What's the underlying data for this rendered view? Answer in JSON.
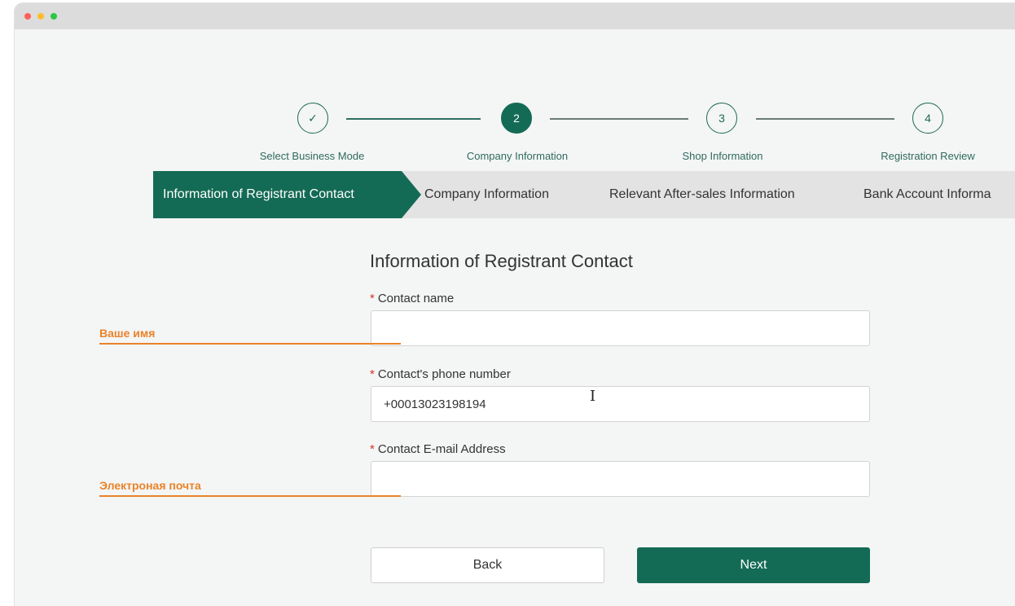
{
  "stepper": {
    "steps": [
      {
        "label": "Select Business Mode",
        "marker": "✓",
        "state": "completed"
      },
      {
        "label": "Company Information",
        "marker": "2",
        "state": "active"
      },
      {
        "label": "Shop Information",
        "marker": "3",
        "state": "pending"
      },
      {
        "label": "Registration Review",
        "marker": "4",
        "state": "pending"
      }
    ]
  },
  "substeps": [
    {
      "label": "Information of Registrant Contact",
      "state": "active"
    },
    {
      "label": "Company Information",
      "state": "inactive"
    },
    {
      "label": "Relevant After-sales Information",
      "state": "inactive"
    },
    {
      "label": "Bank Account Informa",
      "state": "inactive"
    }
  ],
  "form": {
    "title": "Information of Registrant Contact",
    "required_mark": "*",
    "contact_name": {
      "label": "Contact name",
      "value": ""
    },
    "contact_phone": {
      "label": "Contact's phone number",
      "value": "+00013023198194"
    },
    "contact_email": {
      "label": "Contact E-mail Address",
      "value": ""
    }
  },
  "annotations": {
    "name": "Ваше имя",
    "email": "Электроная почта"
  },
  "buttons": {
    "back": "Back",
    "next": "Next"
  },
  "colors": {
    "accent": "#146b55",
    "annotation": "#e9832a",
    "required": "#d93025"
  },
  "icons": {
    "completed_step": "check-icon",
    "text_cursor": "i-beam-cursor-icon"
  }
}
